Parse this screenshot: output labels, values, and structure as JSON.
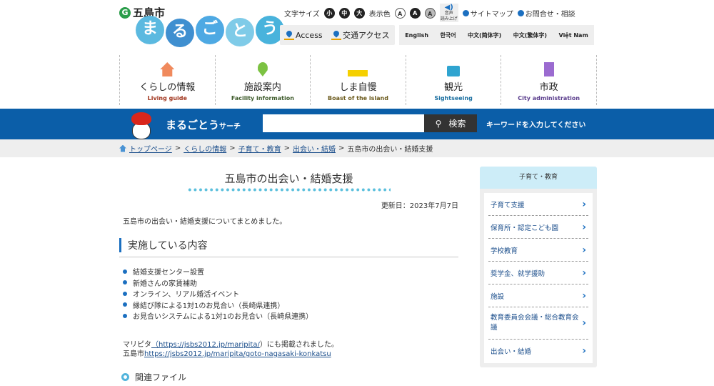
{
  "header": {
    "city_name": "五島市",
    "logo_chars": [
      "ま",
      "る",
      "ご",
      "と",
      "う"
    ],
    "font_size_label": "文字サイズ",
    "font_sizes": [
      "小",
      "中",
      "大"
    ],
    "color_label": "表示色",
    "color_options": [
      "A",
      "A",
      "A"
    ],
    "read_aloud_line1": "音声",
    "read_aloud_line2": "読み上げ",
    "sitemap": "サイトマップ",
    "contact": "お問合せ・相談",
    "access": "Access",
    "transport_access": "交通アクセス",
    "languages": [
      "English",
      "한국어",
      "中文(简体字)",
      "中文(繁体字)",
      "Việt Nam"
    ]
  },
  "global_nav": [
    {
      "jp": "くらしの情報",
      "en": "Living guide",
      "color": "#a0341c"
    },
    {
      "jp": "施設案内",
      "en": "Facility information",
      "color": "#3d5a2a"
    },
    {
      "jp": "しま自慢",
      "en": "Boast of the island",
      "color": "#6b5a1c"
    },
    {
      "jp": "観光",
      "en": "Sightseeing",
      "color": "#1b6fa0"
    },
    {
      "jp": "市政",
      "en": "City administration",
      "color": "#5a3d8c"
    }
  ],
  "search": {
    "title": "まるごとう",
    "title_small": "サーチ",
    "value": "",
    "button": "検索",
    "hint": "キーワードを入力してください"
  },
  "breadcrumb": [
    "トップページ",
    "くらしの情報",
    "子育て・教育",
    "出会い・結婚",
    "五島市の出会い・結婚支援"
  ],
  "breadcrumb_sep": ">",
  "main": {
    "title": "五島市の出会い・結婚支援",
    "updated": "更新日：2023年7月7日",
    "intro": "五島市の出会い・結婚支援についてまとめました。",
    "section_heading": "実施している内容",
    "items": [
      "結婚支援センター設置",
      "新婚さんの家賃補助",
      "オンライン、リアル婚活イベント",
      "縁結び隊による1対1のお見合い（長崎県連携）",
      "お見合いシステムによる1対1のお見合い（長崎県連携）"
    ],
    "link1_prefix": "マリピタ",
    "link1": "（https://jsbs2012.jp/maripita/",
    "link1_suffix": "）にも掲載されました。",
    "link2_prefix": "五島市",
    "link2": "https://jsbs2012.jp/maripita/goto-nagasaki-konkatsu",
    "related_files": "関連ファイル"
  },
  "sidebar": {
    "heading": "子育て・教育",
    "items": [
      "子育て支援",
      "保育所・認定こども園",
      "学校教育",
      "奨学金、就学援助",
      "施設",
      "教育委員会会議・総合教育会議",
      "出会い・結婚"
    ]
  }
}
